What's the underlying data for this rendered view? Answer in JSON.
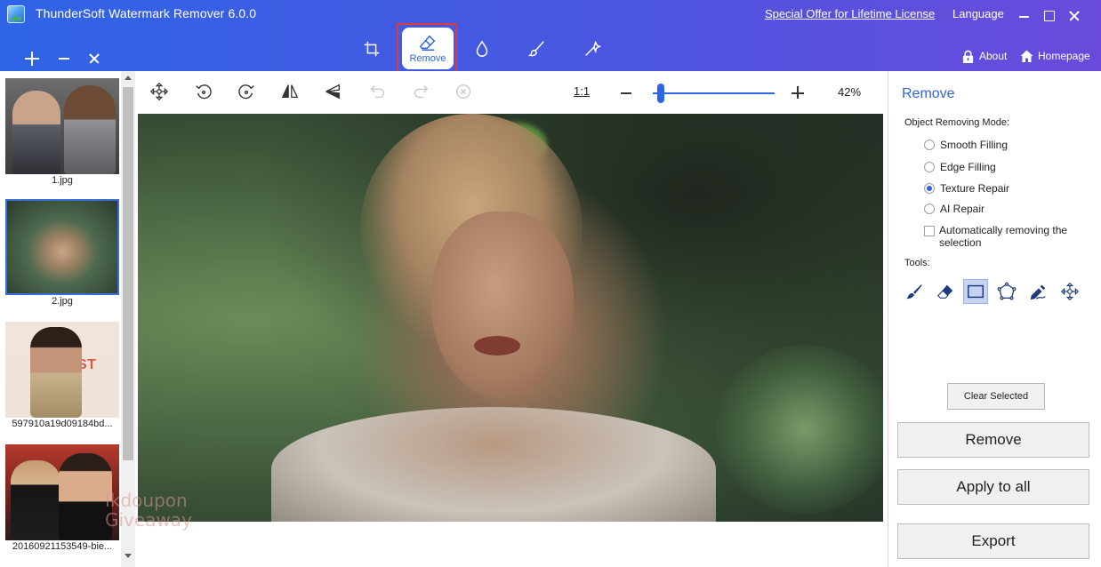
{
  "window": {
    "title": "ThunderSoft Watermark Remover 6.0.0",
    "offer_link": "Special Offer for Lifetime License",
    "language": "Language"
  },
  "modes": {
    "active": "Remove",
    "remove_label": "Remove",
    "icons": [
      "crop-icon",
      "eraser-icon",
      "drop-icon",
      "brush-icon",
      "magic-wand-icon"
    ]
  },
  "header": {
    "about_label": "About",
    "homepage_label": "Homepage"
  },
  "thumbnails": [
    {
      "caption": "1.jpg",
      "selected": false
    },
    {
      "caption": "2.jpg",
      "selected": true
    },
    {
      "caption": "597910a19d09184bd...",
      "selected": false
    },
    {
      "caption": "20160921153549-bie...",
      "selected": false
    }
  ],
  "thumbnail_text": {
    "poster_text": "RIST"
  },
  "edit_toolbar": {
    "ratio_label": "1:1",
    "zoom_percent": "42%",
    "zoom_level": 0.04
  },
  "watermark": {
    "line1": "Ikdoupon",
    "line2": "Giveaway"
  },
  "right_panel": {
    "title": "Remove",
    "mode_label": "Object Removing Mode:",
    "modes": [
      {
        "label": "Smooth Filling",
        "selected": false
      },
      {
        "label": "Edge Filling",
        "selected": false
      },
      {
        "label": "Texture Repair",
        "selected": true
      },
      {
        "label": "AI Repair",
        "selected": false
      }
    ],
    "auto_remove_label": "Automatically removing the selection",
    "auto_remove_checked": false,
    "tools_label": "Tools:",
    "tools": [
      "brush-icon",
      "eraser-icon",
      "rectangle-select-icon",
      "polygon-select-icon",
      "pen-icon",
      "move-icon"
    ],
    "active_tool": "rectangle-select-icon",
    "clear_selected_label": "Clear Selected",
    "remove_label": "Remove",
    "apply_all_label": "Apply to all",
    "export_label": "Export"
  },
  "colors": {
    "accent": "#2f64e6",
    "highlight": "#e0383e"
  }
}
